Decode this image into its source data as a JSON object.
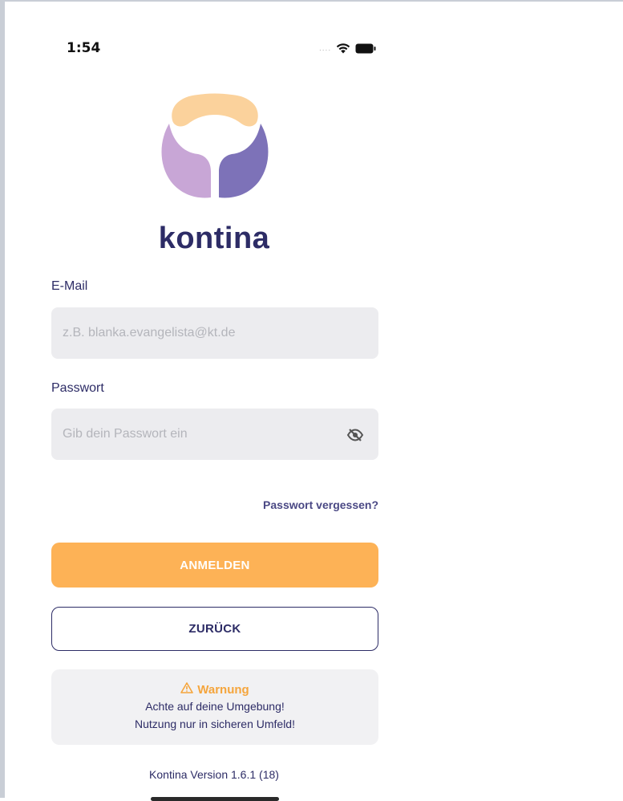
{
  "status_bar": {
    "time": "1:54",
    "signal": "....",
    "wifi_icon": "wifi-icon",
    "battery_icon": "battery-icon"
  },
  "brand": {
    "name": "kontina",
    "colors": {
      "peach": "#fbd29c",
      "lilac": "#c8a6d6",
      "violet": "#7d72b8",
      "navy": "#2d2c66"
    }
  },
  "login": {
    "email_label": "E-Mail",
    "email_placeholder": "z.B. blanka.evangelista@kt.de",
    "email_value": "",
    "password_label": "Passwort",
    "password_placeholder": "Gib dein Passwort ein",
    "password_value": "",
    "visibility_icon": "eye-off-icon",
    "forgot_link": "Passwort vergessen?",
    "login_button": "ANMELDEN",
    "back_button": "ZURÜCK"
  },
  "warning": {
    "icon": "warning-triangle-icon",
    "title": "Warnung",
    "line1": "Achte auf deine Umgebung!",
    "line2": "Nutzung nur in sicheren Umfeld!"
  },
  "footer": {
    "version": "Kontina Version 1.6.1 (18)"
  },
  "colors": {
    "primary": "#fdb256",
    "input_bg": "#ececef",
    "warning": "#f5a53c"
  }
}
